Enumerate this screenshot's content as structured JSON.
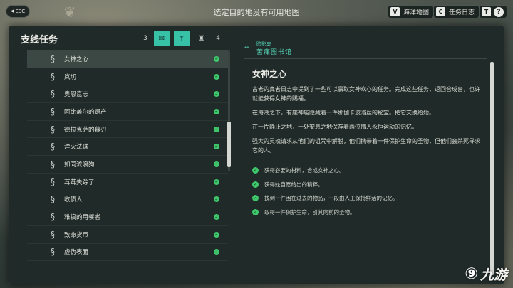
{
  "top_bar": {
    "esc_label": "ESC",
    "title": "选定目的地没有可用地图",
    "buttons": [
      {
        "key": "V",
        "label": "海洋地图"
      },
      {
        "key": "C",
        "label": "任务日志"
      },
      {
        "key": "T",
        "label": "?"
      }
    ]
  },
  "panel": {
    "title": "支线任务",
    "filters": {
      "left_count": "3",
      "right_count": "4",
      "tabs": [
        "mail-icon",
        "dagger-icon",
        "armor-icon"
      ],
      "active_index": 0
    },
    "quests": [
      {
        "name": "女神之心",
        "done": true,
        "selected": true
      },
      {
        "name": "岚切",
        "done": true
      },
      {
        "name": "奥恩意志",
        "done": true
      },
      {
        "name": "阿比盖尔的遗产",
        "done": true
      },
      {
        "name": "德拉克萨的暮刃",
        "done": true
      },
      {
        "name": "湮灭法球",
        "done": true
      },
      {
        "name": "如同流浪狗",
        "done": true
      },
      {
        "name": "茸茸失踪了",
        "done": true
      },
      {
        "name": "收债人",
        "done": true
      },
      {
        "name": "难搞的用餐者",
        "done": true
      },
      {
        "name": "致命货币",
        "done": true
      },
      {
        "name": "虚伪表面",
        "done": true
      }
    ]
  },
  "details": {
    "region": "暗影岛",
    "location": "苦痛图书馆",
    "quest_title": "女神之心",
    "paragraphs": [
      "古老的真者日志中提到了一些可以赢取女神欢心的任务。完成这些任务，返回合成台，也许就能获得女神的赐福。",
      "在海潮之下，有座神庙隐藏着一件娜伽卡波洛丝的秘宝。把它交换给她。",
      "在一片静止之地，一处安息之地保存着两位情人永恒运动的记忆。",
      "强大的灵魂请求从他们的诅咒中解脱，他们携带着一件保护生命的圣物，但他们会杀死寻求它的人。"
    ],
    "objectives": [
      "获得必要的材料，合成女神之心。",
      "获得蛇自愿给出的精粹。",
      "找到一件困在过去的物品，一段由人工保持鲜活的记忆。",
      "取得一件保护生命，引其向前的圣物。"
    ]
  },
  "watermark": {
    "text": "九游"
  },
  "colors": {
    "accent": "#37c2a8",
    "check": "#3fc86b",
    "panel": "#202a28"
  }
}
